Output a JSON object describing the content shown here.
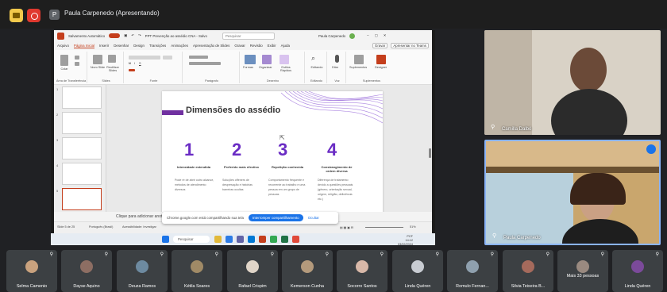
{
  "topbar": {
    "presenter_initial": "P",
    "title": "Paula Carpenedo (Apresentando)"
  },
  "ppt": {
    "autosave_label": "Salvamento Automático",
    "file_title": "PPT Prevenção ao assédio CNA - Salvo",
    "search_placeholder": "Pesquisar",
    "user": "Paula Carpenedo",
    "menu": [
      "Arquivo",
      "Página Inicial",
      "Inserir",
      "Desenhar",
      "Design",
      "Transições",
      "Animações",
      "Apresentação de Slides",
      "Gravar",
      "Revisão",
      "Exibir",
      "Ajuda"
    ],
    "menu_active": 1,
    "record_btn": "Gravar",
    "present_btn": "Apresentar no Teams",
    "ribbon_groups": [
      "Área de Transferência",
      "Slides",
      "Fonte",
      "Parágrafo",
      "Desenho",
      "Editando",
      "Voz",
      "Suplementos"
    ],
    "ribbon_buttons": {
      "paste": "Colar",
      "new_slide": "Novo Slide",
      "reuse": "Reutilizar Slides",
      "shapes": "Formas",
      "arrange": "Organizar",
      "styles": "Estilos Rápidos",
      "edit": "Editando",
      "dictate": "Ditar",
      "addins": "Suplementos",
      "designer": "Designer"
    },
    "thumb_numbers": [
      "1",
      "2",
      "3",
      "4",
      "5"
    ],
    "notes_placeholder": "Clique para adicionar anotações",
    "status_left": "Slide 5 de 25",
    "status_lang": "Português (Brasil)",
    "status_access": "Acessibilidade: Investigar",
    "zoom": "51%"
  },
  "slide": {
    "title": "Dimensões do assédio",
    "columns": [
      {
        "num": "1",
        "sub": "Intensidade estendida",
        "desc": "Pode ré de abrir outro alcance, métodos de atendimento diversos"
      },
      {
        "num": "2",
        "sub": "Preferido mais efectivo",
        "desc": "Soluções offeners de despresação e histórias barreiras ocultas"
      },
      {
        "num": "3",
        "sub": "Repetição conhecida",
        "desc": "Comportamento frequente e recorrente ao trabalho e uma pessoa em um grupo de pessoas"
      },
      {
        "num": "4",
        "sub": "Constrangimento de ordem diversa",
        "desc": "Diferença de tratamento devido a questões pessoais (gênero, orientação sexual, origem, religião, deficiência etc.)"
      }
    ]
  },
  "share_banner": {
    "text": "Chrome.google.com está compartilhando sua tela",
    "stop": "Interromper compartilhamento",
    "hide": "Ocultar"
  },
  "taskbar": {
    "search": "Pesquisar",
    "weather": "PCF",
    "time": "14:12",
    "date": "03/02/2024"
  },
  "right_tiles": [
    {
      "name": "Camilla Dalbó"
    },
    {
      "name": "Paula Carpenedo"
    }
  ],
  "participants": [
    {
      "name": "Selma Camenio",
      "color": "#c9a27e"
    },
    {
      "name": "Dayse Aquino",
      "color": "#8d6e63"
    },
    {
      "name": "Deuza Ramos",
      "color": "#6d8aa0"
    },
    {
      "name": "Kétila Soares",
      "color": "#a08a66"
    },
    {
      "name": "Rafael Crispim",
      "color": "#e0d5c8"
    },
    {
      "name": "Kemerson Cunha",
      "color": "#b49a7c"
    },
    {
      "name": "Socorro Santos",
      "color": "#d8b8a8"
    },
    {
      "name": "Linda Quéren",
      "color": "#c8ccd2"
    },
    {
      "name": "Romulo Fernan...",
      "color": "#8fa0ae"
    },
    {
      "name": "Silvia Teixeira B...",
      "color": "#a56a5c"
    },
    {
      "name": "Mais 33 pessoas",
      "color": "#9a8a80"
    },
    {
      "name": "Linda Quéren",
      "color": "#7b4a9a"
    }
  ]
}
